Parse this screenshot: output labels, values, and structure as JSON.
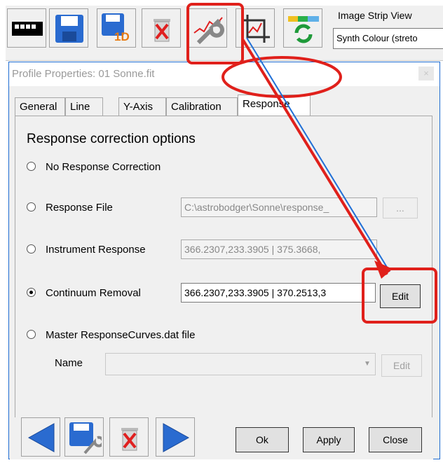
{
  "toolbar": {
    "image_strip_label": "Image Strip View",
    "image_strip_value": "Synth Colour (streto",
    "save_1d_label": "1D"
  },
  "dialog": {
    "title": "Profile Properties: 01 Sonne.fit",
    "close_glyph": "×",
    "tabs": [
      {
        "label": "General"
      },
      {
        "label": "Line"
      },
      {
        "label": "Y-Axis"
      },
      {
        "label": "Calibration"
      },
      {
        "label": "Response"
      }
    ],
    "active_tab": "Response"
  },
  "response": {
    "section_title": "Response correction options",
    "no_response": "No Response Correction",
    "response_file": "Response File",
    "response_file_path": "C:\\astrobodger\\Sonne\\response_",
    "browse_label": "...",
    "instrument_response": "Instrument Response",
    "instrument_value": "366.2307,233.3905 | 375.3668,",
    "continuum_removal": "Continuum Removal",
    "continuum_value": "366.2307,233.3905 | 370.2513,3",
    "edit_label": "Edit",
    "master_curves": "Master ResponseCurves.dat file",
    "name_label": "Name",
    "name_value": "",
    "name_edit_label": "Edit",
    "selected_option": "Continuum Removal"
  },
  "footer": {
    "ok_label": "Ok",
    "apply_label": "Apply",
    "close_label": "Close"
  },
  "colors": {
    "annotation_red": "#e0201b",
    "arrow_blue": "#1f6fd6"
  }
}
